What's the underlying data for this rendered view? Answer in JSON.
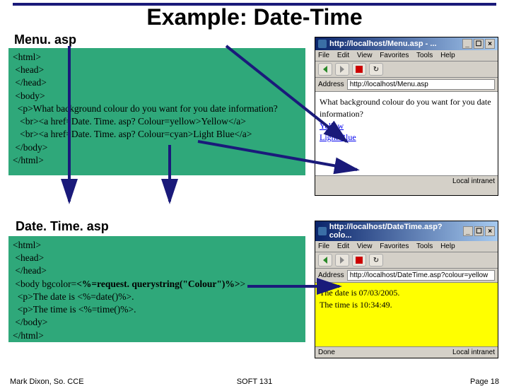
{
  "title": "Example: Date-Time",
  "labels": {
    "menu": "Menu. asp",
    "datetime": "Date. Time. asp"
  },
  "code": {
    "menu": "<html>\n <head>\n </head>\n <body>\n  <p>What background colour do you want for you date information?\n   <br><a href=Date. Time. asp? Colour=yellow>Yellow</a>\n   <br><a href=Date. Time. asp? Colour=cyan>Light Blue</a>\n </body>\n</html>",
    "datetime_pre": "<html>\n <head>\n </head>\n <body bgcolor=",
    "datetime_bold": "<%=request. querystring(\"Colour\")%>",
    "datetime_post": ">\n  <p>The date is <%=date()%>.\n  <p>The time is <%=time()%>.\n </body>\n</html>"
  },
  "browser1": {
    "title": "http://localhost/Menu.asp - ...",
    "menu": [
      "File",
      "Edit",
      "View",
      "Favorites",
      "Tools",
      "Help"
    ],
    "address_label": "Address",
    "address_value": "http://localhost/Menu.asp",
    "body_text": "What background colour do you want for you date information?",
    "link1": "Yellow",
    "link2": "Light Blue",
    "status_right": "Local intranet"
  },
  "browser2": {
    "title": "http://localhost/DateTime.asp?colo...",
    "menu": [
      "File",
      "Edit",
      "View",
      "Favorites",
      "Tools",
      "Help"
    ],
    "address_label": "Address",
    "address_value": "http://localhost/DateTime.asp?colour=yellow",
    "body_line1": "The date is 07/03/2005.",
    "body_line2": "The time is 10:34:49.",
    "status_left": "Done",
    "status_right": "Local intranet"
  },
  "footer": {
    "left": "Mark Dixon, So. CCE",
    "center": "SOFT 131",
    "right": "Page 18"
  }
}
